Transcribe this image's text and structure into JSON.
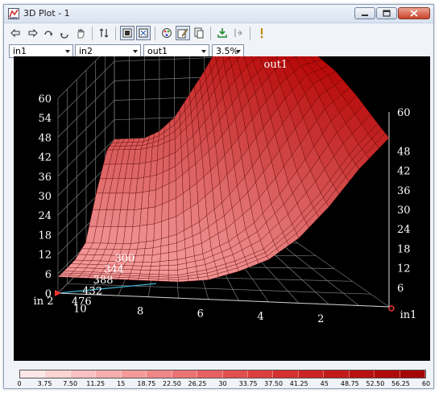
{
  "window": {
    "title": "3D Plot - 1",
    "icon": "3d-plot-app-icon",
    "controls": [
      "minimize-icon",
      "maximize-icon",
      "close-icon"
    ]
  },
  "toolbar": {
    "icons": [
      "rotate-left-icon",
      "rotate-right-icon",
      "rotate-up-icon",
      "rotate-down-icon",
      "pan-hand-icon",
      "flip-axes-icon",
      "grid-view-icon",
      "fit-view-icon",
      "color-palette-icon",
      "edit-pen-icon",
      "copy-icon",
      "import-icon",
      "step-icon",
      "help-icon"
    ]
  },
  "selectors": {
    "x_axis": "in1",
    "y_axis": "in2",
    "z_axis": "out1",
    "step": "3.5%"
  },
  "plot": {
    "z_axis_title": "out1",
    "x_axis_title": "in1",
    "y_axis_title": "in 2",
    "colors": {
      "background": "#000000",
      "grid": "#7a7a7a",
      "surface_low": "#f7a3a3",
      "surface_high": "#b80b0b",
      "mesh": "#5a0000"
    }
  },
  "chart_data": {
    "type": "surface",
    "title": "",
    "xlabel": "in1",
    "ylabel": "in 2",
    "zlabel": "out1",
    "x_ticks": [
      "2",
      "4",
      "6",
      "8",
      "10"
    ],
    "y_ticks": [
      "300",
      "344",
      "388",
      "432",
      "476"
    ],
    "z_ticks_left": [
      "0",
      "6",
      "12",
      "18",
      "24",
      "30",
      "36",
      "42",
      "48",
      "54",
      "60"
    ],
    "z_ticks_right": [
      "6",
      "12",
      "18",
      "24",
      "30",
      "36",
      "42",
      "48",
      "60"
    ],
    "xlim": [
      0,
      11
    ],
    "ylim": [
      270,
      500
    ],
    "zlim": [
      0,
      60
    ],
    "grid": true,
    "surface_values_by_y": [
      {
        "y": 270,
        "z": [
          62,
          62,
          62,
          61,
          58,
          50,
          43,
          36,
          32,
          30,
          30,
          30
        ]
      },
      {
        "y": 300,
        "z": [
          62,
          62,
          61,
          58,
          52,
          44,
          37,
          32,
          30,
          29,
          29,
          29
        ]
      },
      {
        "y": 344,
        "z": [
          62,
          61,
          57,
          50,
          42,
          34,
          28,
          23,
          20,
          19,
          19,
          19
        ]
      },
      {
        "y": 388,
        "z": [
          61,
          57,
          48,
          38,
          28,
          20,
          14,
          10,
          8,
          7,
          7,
          7
        ]
      },
      {
        "y": 432,
        "z": [
          58,
          50,
          38,
          27,
          18,
          12,
          8,
          6,
          5,
          5,
          5,
          5
        ]
      },
      {
        "y": 476,
        "z": [
          54,
          44,
          32,
          22,
          14,
          10,
          7,
          5,
          5,
          5,
          5,
          5
        ]
      },
      {
        "y": 500,
        "z": [
          52,
          42,
          30,
          20,
          13,
          9,
          6,
          5,
          5,
          5,
          5,
          5
        ]
      }
    ],
    "legend": {
      "ticks": [
        "0",
        "3.75",
        "7.50",
        "11.25",
        "15",
        "18.75",
        "22.50",
        "26.25",
        "30",
        "33.75",
        "37.50",
        "41.25",
        "45",
        "48.75",
        "52.50",
        "56.25",
        "60"
      ],
      "colors": [
        "#fde6e6",
        "#fbd4d4",
        "#f9c1c1",
        "#f7adad",
        "#f49a9a",
        "#f08787",
        "#ec7373",
        "#e76060",
        "#e24f4f",
        "#dc3f3f",
        "#d43030",
        "#cc2424",
        "#c31a1a",
        "#ba1212",
        "#b00b0b",
        "#a50606"
      ]
    }
  }
}
